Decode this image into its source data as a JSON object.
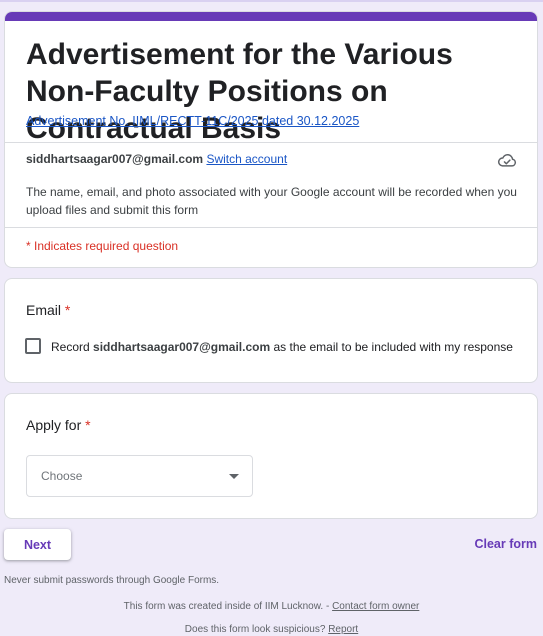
{
  "header": {
    "title": "Advertisement for the Various Non-Faculty Positions on Contractual Basis",
    "description": "Advertisement No. IIML/RECTT-11C/2025 dated 30.12.2025 ",
    "account_email": "siddhartsaagar007@gmail.com",
    "switch_account_label": "Switch account",
    "cloud_icon": "cloud-sync-icon",
    "notice": "The name, email, and photo associated with your Google account will be recorded when you upload files and submit this form",
    "required_note": "* Indicates required question"
  },
  "email_question": {
    "label": "Email",
    "required_mark": "*",
    "checkbox_prefix": "Record ",
    "checkbox_email": "siddhartsaagar007@gmail.com",
    "checkbox_suffix": " as the email to be included with my response",
    "checked": false
  },
  "apply_question": {
    "label": "Apply for",
    "required_mark": "*",
    "dropdown_value": "Choose"
  },
  "nav": {
    "next_label": "Next",
    "clear_label": "Clear form"
  },
  "footer": {
    "warning": "Never submit passwords through Google Forms.",
    "created_text": "This form was created inside of IIM Lucknow. - ",
    "contact_link": "Contact form owner",
    "suspicious_text": "Does this form look suspicious? ",
    "report_link": "Report"
  },
  "colors": {
    "accent": "#673ab7",
    "background": "#efebf9",
    "required": "#d93025",
    "link": "#1a56c6"
  }
}
